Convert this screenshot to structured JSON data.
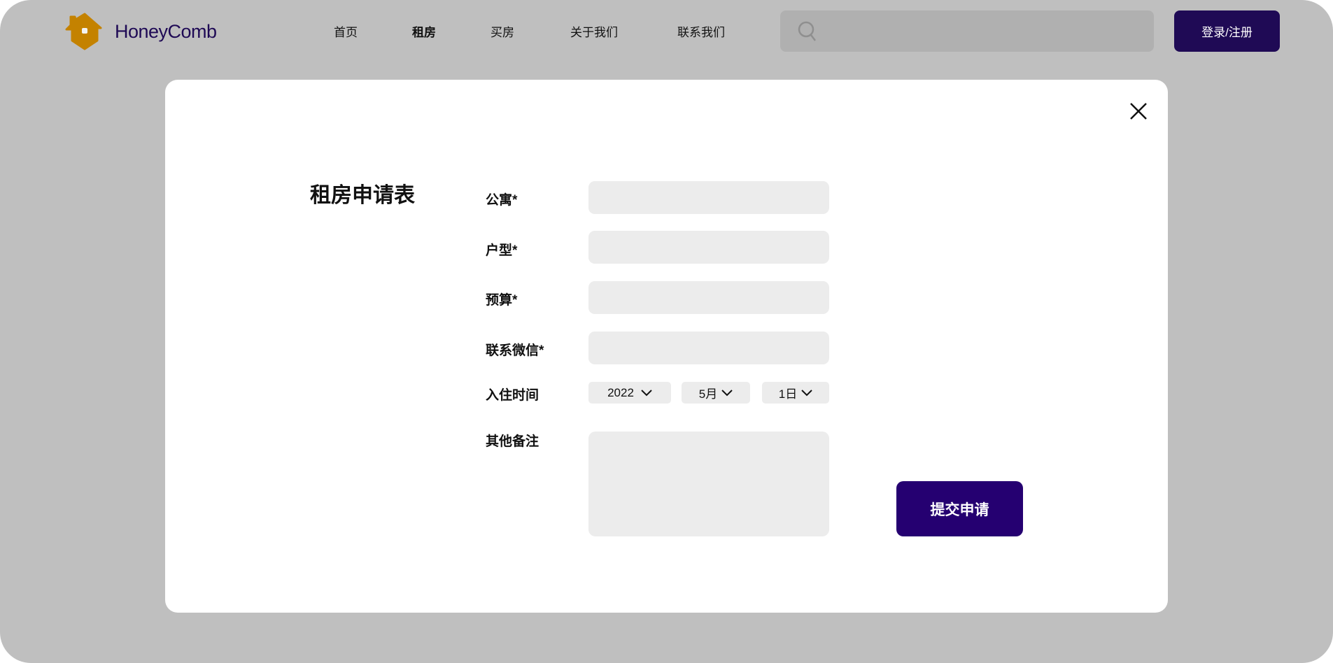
{
  "header": {
    "brand": "HoneyComb",
    "nav": [
      "首页",
      "租房",
      "买房",
      "关于我们",
      "联系我们"
    ],
    "active_nav": "租房",
    "login_label": "登录/注册",
    "search_placeholder": ""
  },
  "modal": {
    "title": "租房申请表",
    "fields": [
      {
        "label": "公寓*",
        "value": ""
      },
      {
        "label": "户型*",
        "value": ""
      },
      {
        "label": "预算*",
        "value": ""
      },
      {
        "label": "联系微信*",
        "value": ""
      }
    ],
    "date_label": "入住时间",
    "year": "2022",
    "month": "5月",
    "day": "1日",
    "notes_label": "其他备注",
    "notes_value": "",
    "submit_label": "提交申请"
  },
  "colors": {
    "brand": "#1f0a55",
    "logo": "#c48200",
    "submit": "#250071"
  }
}
